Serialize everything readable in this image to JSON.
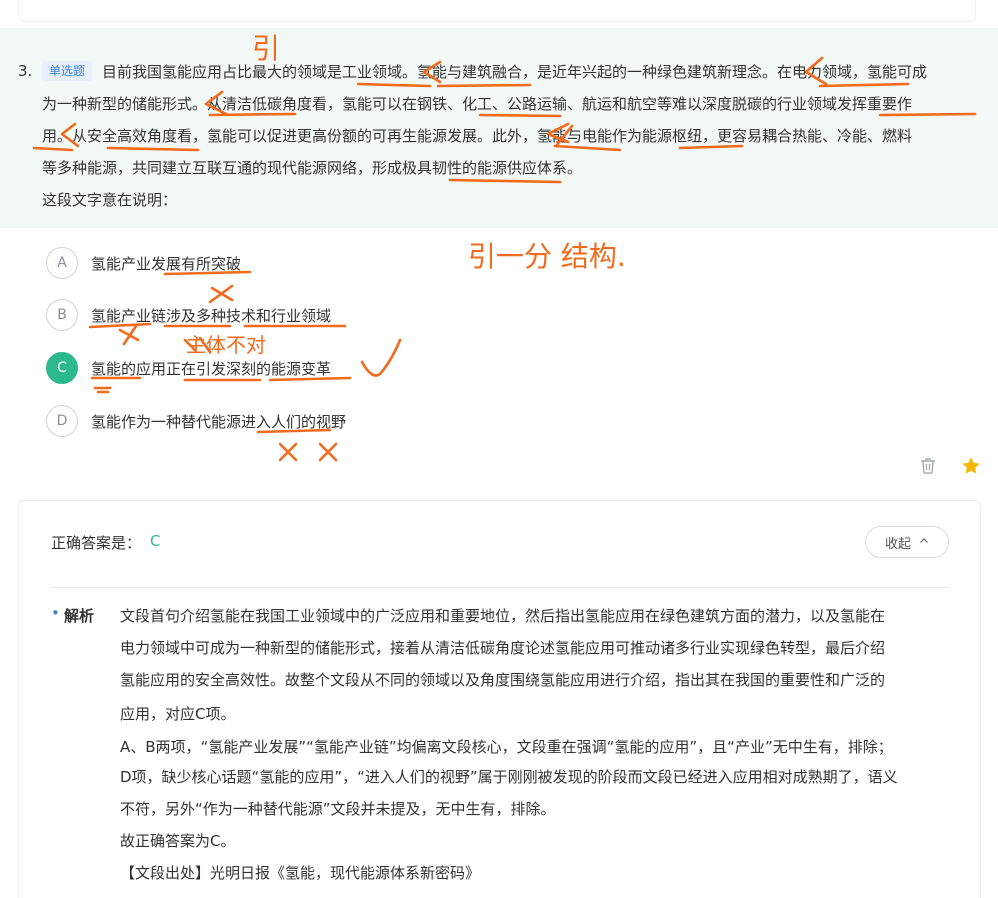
{
  "question": {
    "number": "3.",
    "type_tag": "单选题",
    "stem_lines": [
      "目前我国氢能应用占比最大的领域是工业领域。氢能与建筑融合，是近年兴起的一种绿色建筑新理念。在电力领域，氢能可成",
      "为一种新型的储能形式。从清洁低碳角度看，氢能可以在钢铁、化工、公路运输、航运和航空等难以深度脱碳的行业领域发挥重要作",
      "用。从安全高效角度看，氢能可以促进更高份额的可再生能源发展。此外，氢能与电能作为能源枢纽，更容易耦合热能、冷能、燃料",
      "等多种能源，共同建立互联互通的现代能源网络，形成极具韧性的能源供应体系。"
    ],
    "ask": "这段文字意在说明：",
    "options": [
      {
        "letter": "A",
        "text": "氢能产业发展有所突破",
        "state": "normal"
      },
      {
        "letter": "B",
        "text": "氢能产业链涉及多种技术和行业领域",
        "state": "normal"
      },
      {
        "letter": "C",
        "text": "氢能的应用正在引发深刻的能源变革",
        "state": "correct"
      },
      {
        "letter": "D",
        "text": "氢能作为一种替代能源进入人们的视野",
        "state": "normal"
      }
    ]
  },
  "icons": {
    "delete": "trash-icon",
    "favorite": "star-icon",
    "collapse": "chevron-up-icon"
  },
  "answer": {
    "label": "正确答案是：",
    "value": "C",
    "collapse_label": "收起"
  },
  "analysis": {
    "title": "解析",
    "lines": [
      "文段首句介绍氢能在我国工业领域中的广泛应用和重要地位，然后指出氢能应用在绿色建筑方面的潜力，以及氢能在",
      "电力领域中可成为一种新型的储能形式，接着从清洁低碳角度论述氢能应用可推动诸多行业实现绿色转型，最后介绍",
      "氢能应用的安全高效性。故整个文段从不同的领域以及角度围绕氢能应用进行介绍，指出其在我国的重要性和广泛的",
      "应用，对应C项。",
      "A、B两项，“氢能产业发展”“氢能产业链”均偏离文段核心，文段重在强调“氢能的应用”，且“产业”无中生有，排除；",
      "D项，缺少核心话题“氢能的应用”，“进入人们的视野”属于刚刚被发现的阶段而文段已经进入应用相对成熟期了，语义",
      "不符，另外“作为一种替代能源”文段并未提及，无中生有，排除。",
      "故正确答案为C。",
      "【文段出处】光明日报《氢能，现代能源体系新密码》"
    ]
  },
  "annotations": {
    "ink_color": "#f26a1b",
    "notes": [
      "引",
      "引一分 结构.",
      "主体不对"
    ]
  },
  "colors": {
    "accent_green": "#2bb98d",
    "tag_blue": "#3f83d6",
    "stem_background": "#f1f8f5",
    "star_yellow": "#f5b800"
  }
}
